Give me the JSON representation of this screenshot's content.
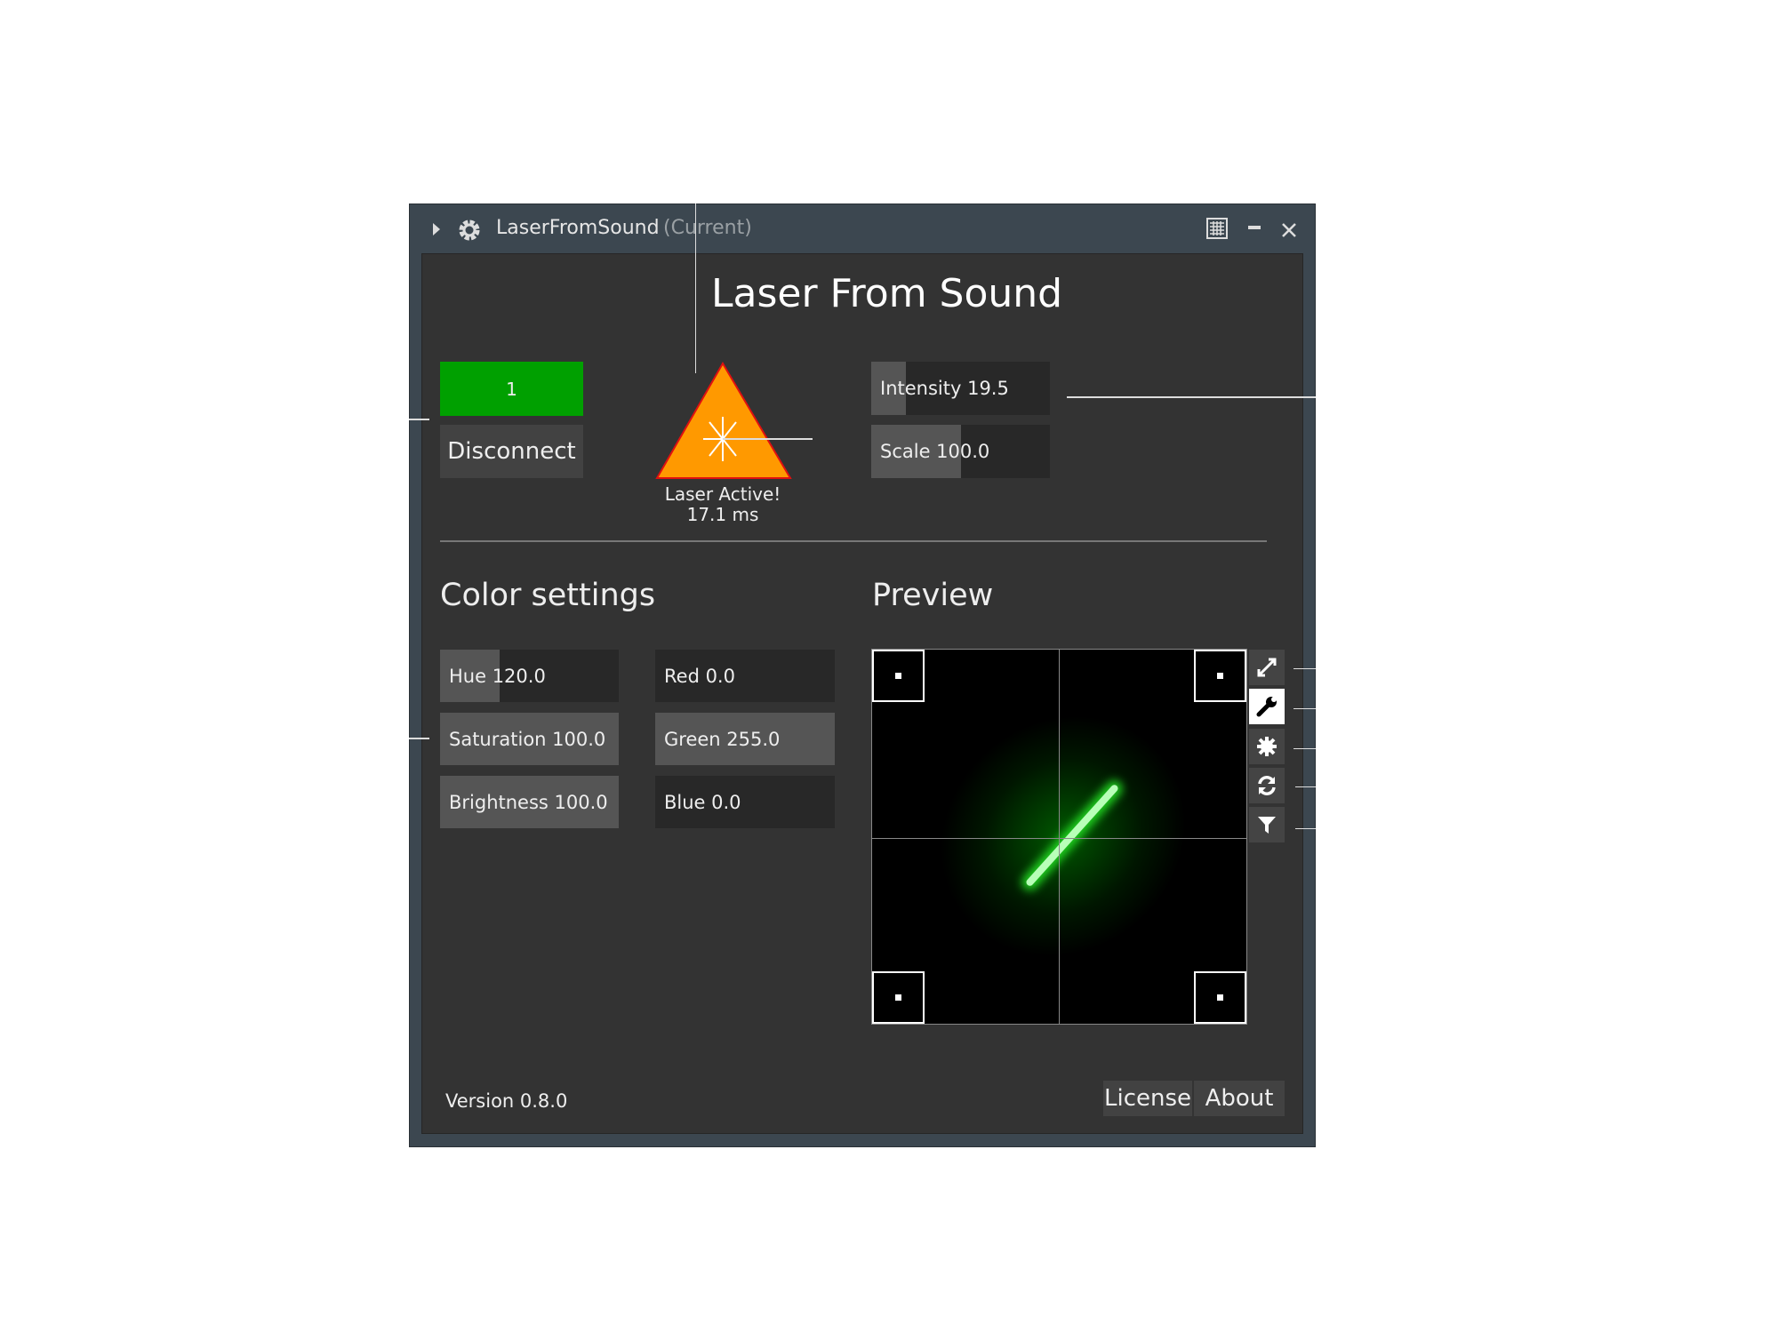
{
  "window": {
    "title": "LaserFromSound",
    "title_suffix": "(Current)"
  },
  "header": {
    "title": "Laser From Sound"
  },
  "device": {
    "id_label": "1",
    "status_color": "#00a000",
    "disconnect_label": "Disconnect"
  },
  "laser": {
    "status": "Laser Active!",
    "latency": "17.1 ms",
    "warning_color": "#ff9900"
  },
  "output": {
    "intensity": {
      "label": "Intensity 19.5",
      "value": 19.5,
      "fraction": 0.195
    },
    "scale": {
      "label": "Scale 100.0",
      "value": 100.0,
      "fraction": 0.5
    }
  },
  "color_settings": {
    "title": "Color settings",
    "hsb": [
      {
        "label": "Hue 120.0",
        "fraction": 0.333
      },
      {
        "label": "Saturation 100.0",
        "fraction": 1
      },
      {
        "label": "Brightness 100.0",
        "fraction": 1
      }
    ],
    "rgb": [
      {
        "label": "Red 0.0",
        "fraction": 0
      },
      {
        "label": "Green 255.0",
        "fraction": 1
      },
      {
        "label": "Blue 0.0",
        "fraction": 0
      }
    ]
  },
  "preview": {
    "title": "Preview",
    "tools": [
      "expand-icon",
      "wrench-icon",
      "puzzle-icon",
      "refresh-icon",
      "filter-icon"
    ],
    "active_tool": "wrench-icon"
  },
  "footer": {
    "version": "Version 0.8.0",
    "license_label": "License",
    "about_label": "About"
  }
}
